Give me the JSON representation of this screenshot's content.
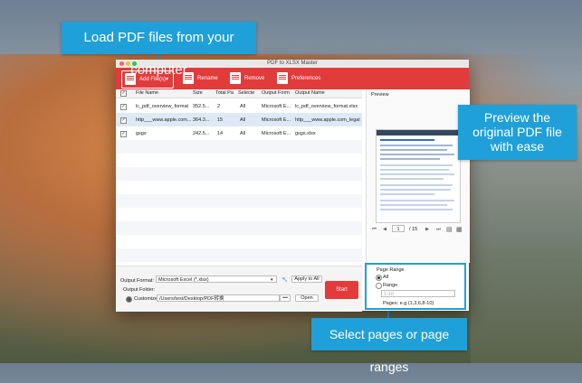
{
  "callouts": {
    "load": "Load PDF files from your computer",
    "preview_l1": "Preview the",
    "preview_l2": "original PDF file",
    "preview_l3": "with ease",
    "pages": "Select pages or page ranges"
  },
  "window": {
    "title": "PDF to XLSX Master"
  },
  "toolbar": {
    "add": "Add File(s)",
    "rename": "Rename",
    "remove": "Remove",
    "preferences": "Preferences"
  },
  "table": {
    "headers": [
      "File Name",
      "Size",
      "Total Pa",
      "Selecte",
      "Output Form",
      "Output Name"
    ],
    "rows": [
      {
        "name": "lc_pdf_overview_format",
        "size": "352.5...",
        "total": "2",
        "selected": "All",
        "format": "Microsoft E...",
        "output": "lc_pdf_overview_format.xlsx"
      },
      {
        "name": "http___www.apple.com...",
        "size": "364.3...",
        "total": "15",
        "selected": "All",
        "format": "Microsoft E...",
        "output": "http___www.apple.com_legal..."
      },
      {
        "name": "gsgs",
        "size": "242.5...",
        "total": "14",
        "selected": "All",
        "format": "Microsoft E...",
        "output": "gsgs.xlsx"
      }
    ]
  },
  "preview": {
    "label": "Preview",
    "page": "1",
    "total": "/ 15"
  },
  "output": {
    "format_label": "Output Format:",
    "format_value": "Microsoft Excel (*.xlsx)",
    "apply_all": "Apply to All",
    "folder_label": "Output Folder:",
    "customize_label": "Customize:",
    "folder_value": "/Users/test/Desktop/PDF转换",
    "more": "•••",
    "open": "Open",
    "start": "Start"
  },
  "page_range": {
    "title": "Page Range",
    "all": "All",
    "range": "Range",
    "placeholder": "1-10",
    "hint": "Pages: e.g.(1,3,6,8-10)"
  },
  "colors": {
    "accent": "#1fa0d8",
    "toolbar": "#e23b3b"
  }
}
